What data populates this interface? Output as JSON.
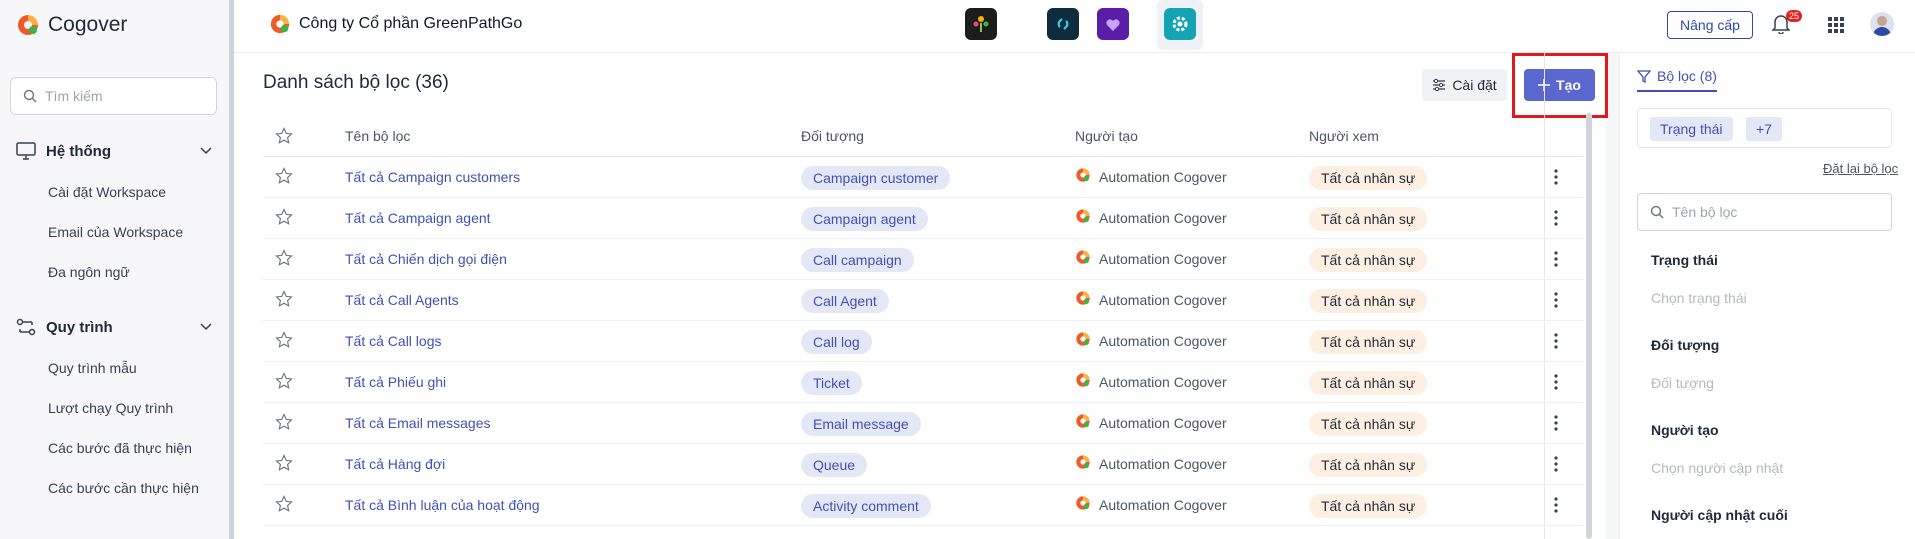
{
  "brand": {
    "name": "Cogover"
  },
  "sidebar": {
    "search_placeholder": "Tìm kiếm",
    "sections": [
      {
        "label": "Hệ thống",
        "icon": "monitor-icon",
        "items": [
          "Cài đặt Workspace",
          "Email của Workspace",
          "Đa ngôn ngữ"
        ]
      },
      {
        "label": "Quy trình",
        "icon": "workflow-icon",
        "items": [
          "Quy trình mẫu",
          "Lượt chạy Quy trình",
          "Các bước đã thực hiện",
          "Các bước cần thực hiện"
        ]
      }
    ]
  },
  "header": {
    "company": "Công ty Cổ phần GreenPathGo",
    "apps": [
      "tree-app-icon",
      "link-app-icon",
      "heart-app-icon",
      "settings-app-icon"
    ],
    "upgrade_label": "Nâng cấp",
    "notification_count": "25"
  },
  "main": {
    "title": "Danh sách bộ lọc (36)",
    "settings_label": "Cài đặt",
    "create_label": "Tạo",
    "columns": [
      "Tên bộ lọc",
      "Đối tượng",
      "Người tạo",
      "Người xem"
    ],
    "rows": [
      {
        "name": "Tất cả Campaign customers",
        "object": "Campaign customer",
        "creator": "Automation Cogover",
        "viewer": "Tất cả nhân sự"
      },
      {
        "name": "Tất cả Campaign agent",
        "object": "Campaign agent",
        "creator": "Automation Cogover",
        "viewer": "Tất cả nhân sự"
      },
      {
        "name": "Tất cả Chiến dịch gọi điện",
        "object": "Call campaign",
        "creator": "Automation Cogover",
        "viewer": "Tất cả nhân sự"
      },
      {
        "name": "Tất cả Call Agents",
        "object": "Call Agent",
        "creator": "Automation Cogover",
        "viewer": "Tất cả nhân sự"
      },
      {
        "name": "Tất cả Call logs",
        "object": "Call log",
        "creator": "Automation Cogover",
        "viewer": "Tất cả nhân sự"
      },
      {
        "name": "Tất cả Phiếu ghi",
        "object": "Ticket",
        "creator": "Automation Cogover",
        "viewer": "Tất cả nhân sự"
      },
      {
        "name": "Tất cả Email messages",
        "object": "Email message",
        "creator": "Automation Cogover",
        "viewer": "Tất cả nhân sự"
      },
      {
        "name": "Tất cả Hàng đợi",
        "object": "Queue",
        "creator": "Automation Cogover",
        "viewer": "Tất cả nhân sự"
      },
      {
        "name": "Tất cả Bình luận của hoạt động",
        "object": "Activity comment",
        "creator": "Automation Cogover",
        "viewer": "Tất cả nhân sự"
      }
    ]
  },
  "filter_panel": {
    "tab_label": "Bộ lọc (8)",
    "chips": [
      "Trạng thái",
      "+7"
    ],
    "reset_label": "Đặt lại bộ lọc",
    "search_placeholder": "Tên bộ lọc",
    "fields": [
      {
        "label": "Trạng thái",
        "placeholder": "Chọn trạng thái"
      },
      {
        "label": "Đối tượng",
        "placeholder": "Đối tượng"
      },
      {
        "label": "Người tạo",
        "placeholder": "Chọn người cập nhật"
      },
      {
        "label": "Người cập nhật cuối",
        "placeholder": ""
      }
    ]
  },
  "colors": {
    "accent": "#5a67cf",
    "link": "#3f51b5",
    "highlight": "#e01919"
  }
}
